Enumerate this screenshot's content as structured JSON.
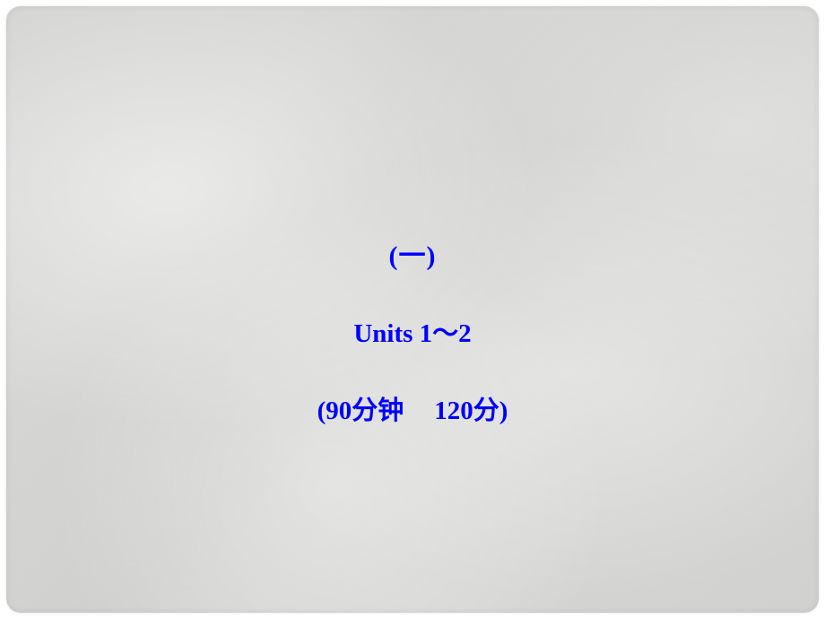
{
  "slide": {
    "line1": "(一)",
    "line2": "Units 1～2",
    "line3_part1": "(90分钟",
    "line3_part2": "120分)"
  }
}
